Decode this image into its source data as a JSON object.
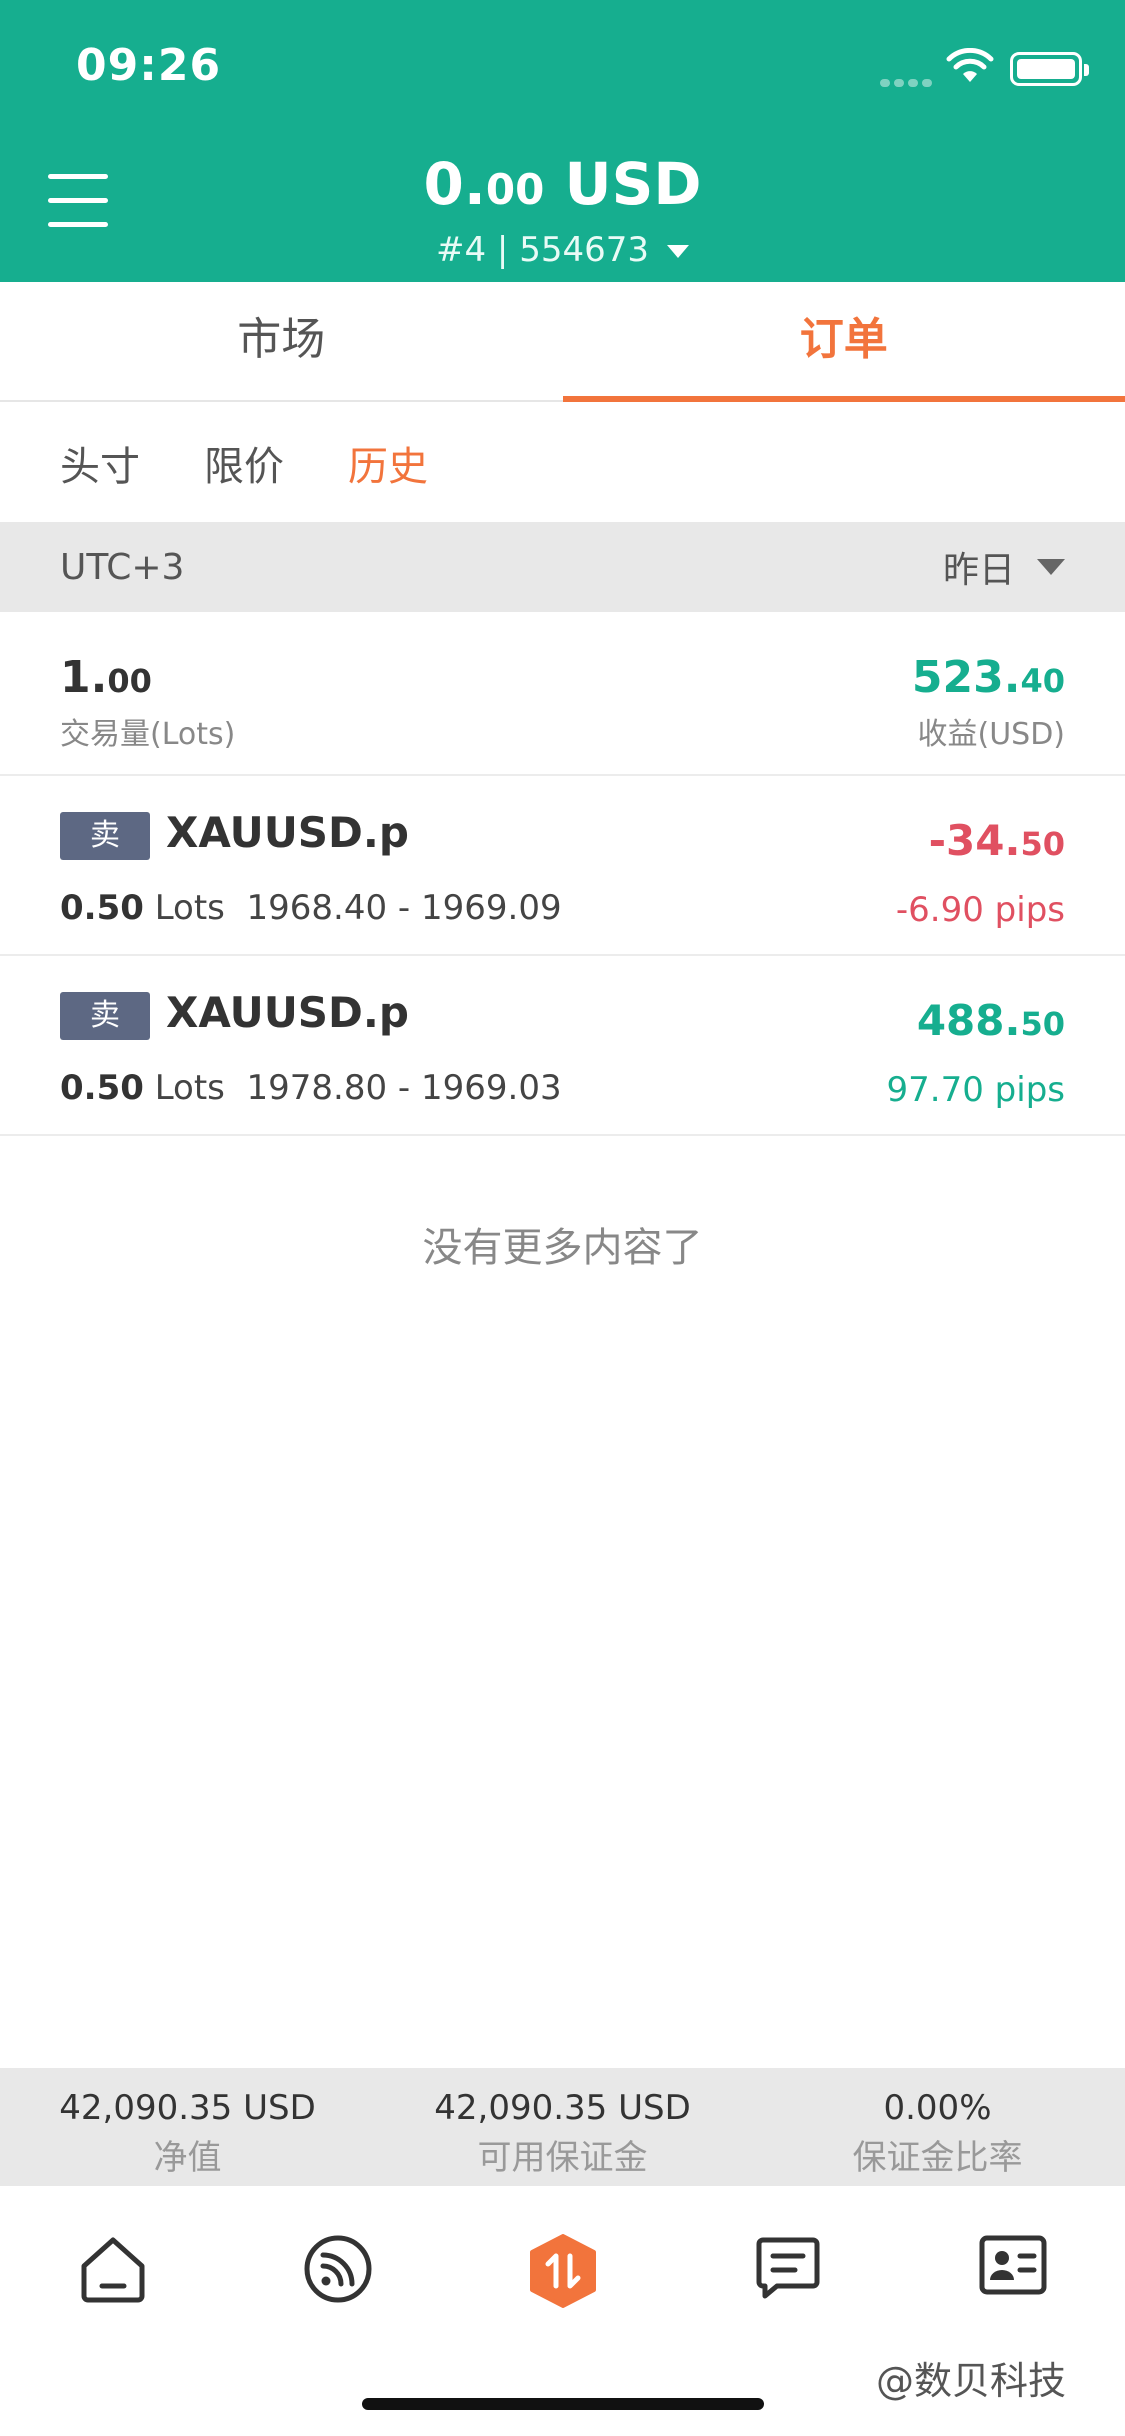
{
  "status": {
    "time": "09:26"
  },
  "header": {
    "balance_int": "0.",
    "balance_dec": "00",
    "balance_currency": " USD",
    "account": "#4 | 554673"
  },
  "main_tabs": [
    {
      "label": "市场",
      "active": false
    },
    {
      "label": "订单",
      "active": true
    }
  ],
  "sub_tabs": [
    {
      "label": "头寸",
      "active": false
    },
    {
      "label": "限价",
      "active": false
    },
    {
      "label": "历史",
      "active": true
    }
  ],
  "filter": {
    "timezone": "UTC+3",
    "period": "昨日"
  },
  "summary": {
    "volume_int": "1.",
    "volume_dec": "00",
    "volume_label": "交易量(Lots)",
    "profit_int": "523.",
    "profit_dec": "40",
    "profit_label": "收益(USD)"
  },
  "orders": [
    {
      "side": "卖",
      "symbol": "XAUUSD.p",
      "lots": "0.50",
      "lots_unit": " Lots",
      "price_range": "1968.40 - 1969.09",
      "profit_int": "-34.",
      "profit_dec": "50",
      "pips": "-6.90 pips",
      "color": "#e05061"
    },
    {
      "side": "卖",
      "symbol": "XAUUSD.p",
      "lots": "0.50",
      "lots_unit": " Lots",
      "price_range": "1978.80 - 1969.03",
      "profit_int": "488.",
      "profit_dec": "50",
      "pips": "97.70 pips",
      "color": "#16ae8f"
    }
  ],
  "no_more_text": "没有更多内容了",
  "footer_stats": [
    {
      "value": "42,090.35 USD",
      "label": "净值"
    },
    {
      "value": "42,090.35 USD",
      "label": "可用保证金"
    },
    {
      "value": "0.00%",
      "label": "保证金比率"
    }
  ],
  "bottom_nav": [
    {
      "icon": "home-icon"
    },
    {
      "icon": "feed-icon"
    },
    {
      "icon": "trade-icon"
    },
    {
      "icon": "news-icon"
    },
    {
      "icon": "profile-card-icon"
    }
  ],
  "watermark": "@数贝科技",
  "colors": {
    "brand": "#16ae8f",
    "accent": "#f2743c",
    "loss": "#e05061",
    "badge": "#5d6883"
  }
}
